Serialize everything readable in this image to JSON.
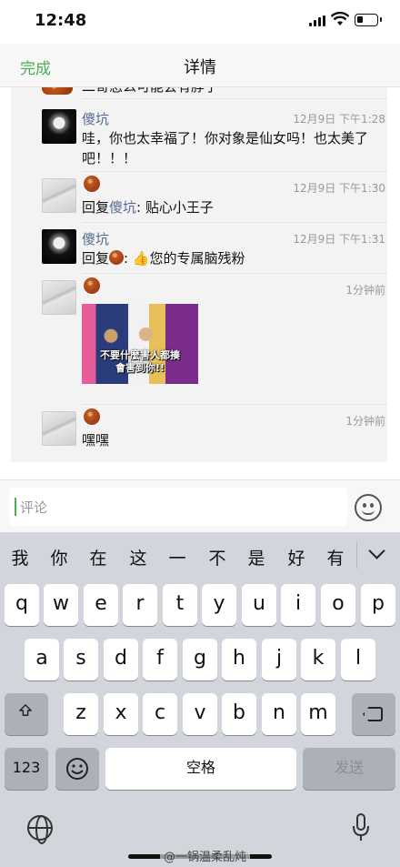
{
  "status_bar": {
    "time": "12:48"
  },
  "nav": {
    "done_label": "完成",
    "title": "详情"
  },
  "feed": {
    "partial_text": "二哥怎么可能会有脖子",
    "comments": [
      {
        "name": "傻坑",
        "time": "12月9日 下午1:28",
        "text": "哇，你也太幸福了！你对象是仙女吗！也太美了吧！！！"
      },
      {
        "time": "12月9日 下午1:30",
        "prefix": "回复",
        "target": "傻坑",
        "text": ": 贴心小王子"
      },
      {
        "name": "傻坑",
        "time": "12月9日 下午1:31",
        "prefix": "回复",
        "text": ": 👍您的专属脑残粉"
      },
      {
        "time": "1分钟前",
        "image_caption_line1": "不要什麼害人都揍",
        "image_caption_line2": "會害到你!!"
      },
      {
        "time": "1分钟前",
        "text": "嘿嘿"
      }
    ]
  },
  "comment_bar": {
    "placeholder": "评论",
    "emoji_icon": "smiley-icon"
  },
  "keyboard": {
    "candidates": [
      "我",
      "你",
      "在",
      "这",
      "一",
      "不",
      "是",
      "好",
      "有"
    ],
    "row1": [
      "q",
      "w",
      "e",
      "r",
      "t",
      "y",
      "u",
      "i",
      "o",
      "p"
    ],
    "row2": [
      "a",
      "s",
      "d",
      "f",
      "g",
      "h",
      "j",
      "k",
      "l"
    ],
    "row3": [
      "z",
      "x",
      "c",
      "v",
      "b",
      "n",
      "m"
    ],
    "numbers_label": "123",
    "space_label": "空格",
    "send_label": "发送"
  },
  "watermark": "@一锅温柔乱炖"
}
